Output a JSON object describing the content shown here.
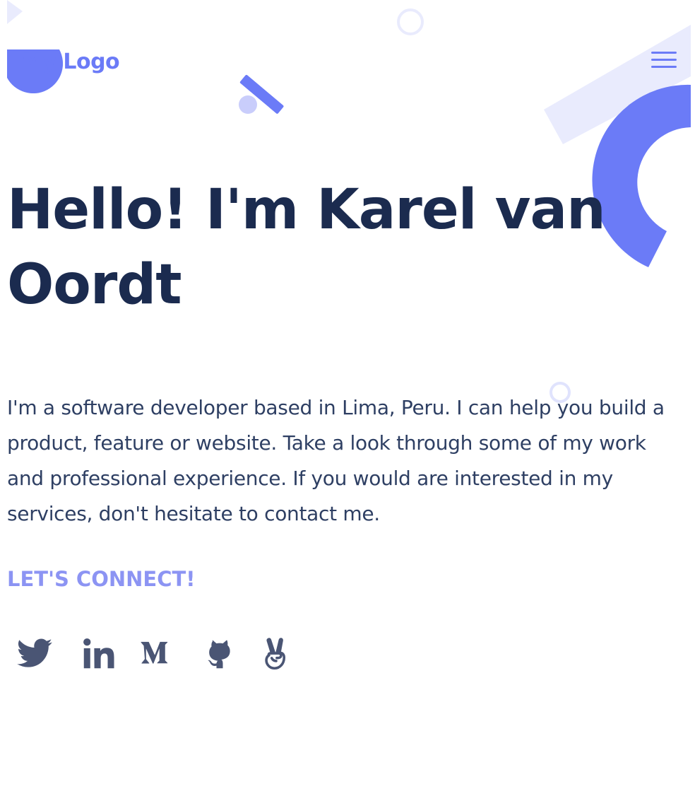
{
  "header": {
    "logo_text": "My Logo",
    "menu_icon": "hamburger-menu-icon"
  },
  "hero": {
    "title_line1": "Hello! I'm Karel van",
    "title_line2": "Oordt",
    "intro": "I'm a software developer based in Lima, Peru. I can help you build a product, feature or website. Take a look through some of my work and professional experience. If you would are interested in my services, don't hesitate to contact me.",
    "connect_label": "LET'S CONNECT!"
  },
  "socials": [
    {
      "icon": "twitter-icon"
    },
    {
      "icon": "linkedin-icon"
    },
    {
      "icon": "medium-icon"
    },
    {
      "icon": "github-icon"
    },
    {
      "icon": "angellist-icon"
    }
  ],
  "colors": {
    "accent": "#6b7bf7",
    "accent_light": "#e9ebfd",
    "heading": "#1b2b4f",
    "body_text": "#2e3f63",
    "connect": "#8c94f3",
    "icon": "#4a5574"
  }
}
